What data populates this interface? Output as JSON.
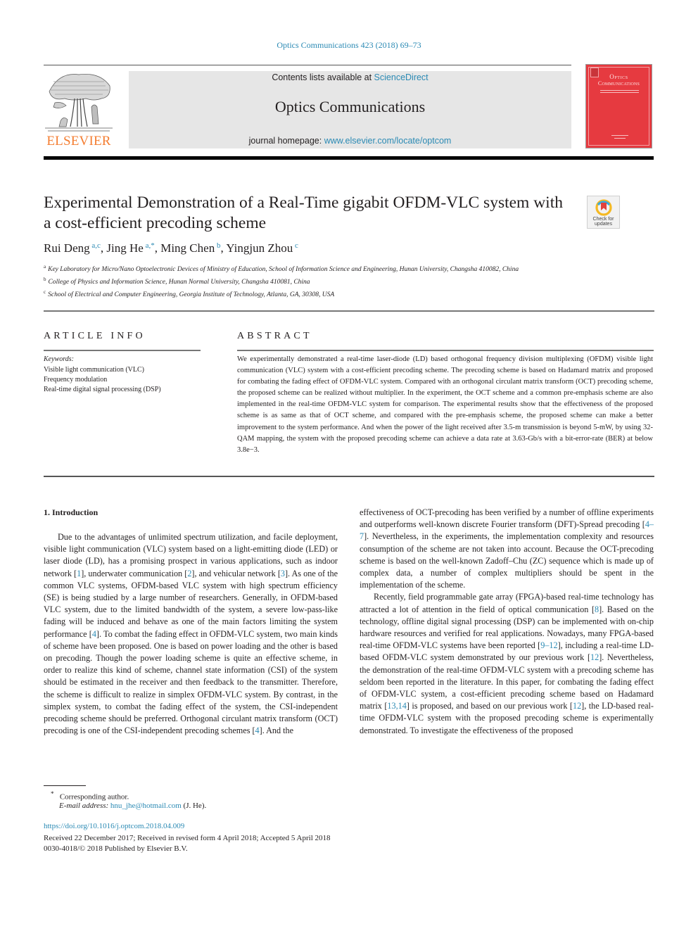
{
  "header": {
    "journal_ref": "Optics Communications 423 (2018) 69–73",
    "contents_prefix": "Contents lists available at ",
    "contents_link": "ScienceDirect",
    "journal_title": "Optics Communications",
    "homepage_prefix": "journal homepage: ",
    "homepage_link": "www.elsevier.com/locate/optcom",
    "publisher_logo_text": "ELSEVIER",
    "cover_title_line1": "Optics",
    "cover_title_line2": "Communications"
  },
  "article": {
    "title": "Experimental Demonstration of a Real-Time gigabit OFDM-VLC system with a cost-efficient precoding scheme",
    "crossmark_label_1": "Check for",
    "crossmark_label_2": "updates",
    "authors": [
      {
        "name": "Rui Deng",
        "sup": "a,c"
      },
      {
        "name": "Jing He",
        "sup": "a,*"
      },
      {
        "name": "Ming Chen",
        "sup": "b"
      },
      {
        "name": "Yingjun Zhou",
        "sup": "c"
      }
    ],
    "author_separator": ", ",
    "affiliations": [
      {
        "key": "a",
        "text": "Key Laboratory for Micro/Nano Optoelectronic Devices of Ministry of Education, School of Information Science and Engineering, Hunan University, Changsha 410082, China"
      },
      {
        "key": "b",
        "text": "College of Physics and Information Science, Hunan Normal University, Changsha 410081, China"
      },
      {
        "key": "c",
        "text": "School of Electrical and Computer Engineering, Georgia Institute of Technology, Atlanta, GA, 30308, USA"
      }
    ]
  },
  "article_info": {
    "heading": "ARTICLE INFO",
    "keywords_label": "Keywords:",
    "keywords": [
      "Visible light communication (VLC)",
      "Frequency modulation",
      "Real-time digital signal processing (DSP)"
    ]
  },
  "abstract": {
    "heading": "ABSTRACT",
    "text": "We experimentally demonstrated a real-time laser-diode (LD) based orthogonal frequency division multiplexing (OFDM) visible light communication (VLC) system with a cost-efficient precoding scheme. The precoding scheme is based on Hadamard matrix and proposed for combating the fading effect of OFDM-VLC system. Compared with an orthogonal circulant matrix transform (OCT) precoding scheme, the proposed scheme can be realized without multiplier. In the experiment, the OCT scheme and a common pre-emphasis scheme are also implemented in the real-time OFDM-VLC system for comparison. The experimental results show that the effectiveness of the proposed scheme is as same as that of OCT scheme, and compared with the pre-emphasis scheme, the proposed scheme can make a better improvement to the system performance. And when the power of the light received after 3.5-m transmission is beyond 5-mW, by using 32-QAM mapping, the system with the proposed precoding scheme can achieve a data rate at 3.63-Gb/s with a bit-error-rate (BER) at below 3.8e−3."
  },
  "body": {
    "section_heading": "1.  Introduction",
    "left_column": [
      {
        "t": "Due to the advantages of unlimited spectrum utilization, and facile deployment, visible light communication (VLC) system based on a light-emitting diode (LED) or laser diode (LD), has a promising prospect in various applications, such as indoor network "
      },
      {
        "c": "[1]"
      },
      {
        "t": ", underwater communication "
      },
      {
        "c": "[2]"
      },
      {
        "t": ", and vehicular network "
      },
      {
        "c": "[3]"
      },
      {
        "t": ". As one of the common VLC systems, OFDM-based VLC system with high spectrum efficiency (SE) is being studied by a large number of researchers. Generally, in OFDM-based VLC system, due to the limited bandwidth of the system, a severe low-pass-like fading will be induced and behave as one of the main factors limiting the system performance "
      },
      {
        "c": "[4]"
      },
      {
        "t": ". To combat the fading effect in OFDM-VLC system, two main kinds of scheme have been proposed. One is based on power loading and the other is based on precoding. Though the power loading scheme is quite an effective scheme, in order to realize this kind of scheme, channel state information (CSI) of the system should be estimated in the receiver and then feedback to the transmitter. Therefore, the scheme is difficult to realize in simplex OFDM-VLC system. By contrast, in the simplex system, to combat the fading effect of the system, the CSI-independent precoding scheme should be preferred. Orthogonal circulant matrix transform (OCT) precoding is one of the CSI-independent precoding schemes "
      },
      {
        "c": "[4]"
      },
      {
        "t": ". And the"
      }
    ],
    "right_column_p1": [
      {
        "t": "effectiveness of OCT-precoding has been verified by a number of offline experiments and outperforms well-known discrete Fourier transform (DFT)-Spread precoding "
      },
      {
        "c": "[4–7]"
      },
      {
        "t": ". Nevertheless, in the experiments, the implementation complexity and resources consumption of the scheme are not taken into account. Because the OCT-precoding scheme is based on the well-known Zadoff–Chu (ZC) sequence which is made up of complex data, a number of complex multipliers should be spent in the implementation of the scheme."
      }
    ],
    "right_column_p2": [
      {
        "t": "Recently, field programmable gate array (FPGA)-based real-time technology has attracted a lot of attention in the field of optical communication "
      },
      {
        "c": "[8]"
      },
      {
        "t": ". Based on the technology, offline digital signal processing (DSP) can be implemented with on-chip hardware resources and verified for real applications. Nowadays, many FPGA-based real-time OFDM-VLC systems have been reported "
      },
      {
        "c": "[9–12]"
      },
      {
        "t": ", including a real-time LD-based OFDM-VLC system demonstrated by our previous work "
      },
      {
        "c": "[12]"
      },
      {
        "t": ". Nevertheless, the demonstration of the real-time OFDM-VLC system with a precoding scheme has seldom been reported in the literature. In this paper, for combating the fading effect of OFDM-VLC system, a cost-efficient precoding scheme based on Hadamard matrix "
      },
      {
        "c": "[13,14]"
      },
      {
        "t": " is proposed, and based on our previous work "
      },
      {
        "c": "[12]"
      },
      {
        "t": ", the LD-based real-time OFDM-VLC system with the proposed precoding scheme is experimentally demonstrated. To investigate the effectiveness of the proposed"
      }
    ]
  },
  "footnotes": {
    "star": "*",
    "corresponding": "Corresponding author.",
    "email_label": "E-mail address:",
    "email": "hnu_jhe@hotmail.com",
    "email_suffix": " (J. He).",
    "doi": "https://doi.org/10.1016/j.optcom.2018.04.009",
    "dates": "Received 22 December 2017; Received in revised form 4 April 2018; Accepted 5 April 2018",
    "copyright": "0030-4018/© 2018 Published by Elsevier B.V."
  },
  "colors": {
    "link": "#2b8ab4",
    "elsevier_orange": "#f47d31",
    "cover_red": "#e63a40",
    "banner_grey": "#e6e6e6"
  }
}
